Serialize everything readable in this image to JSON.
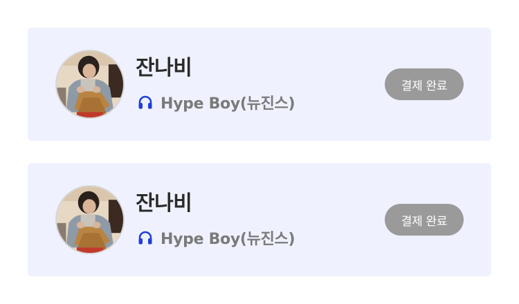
{
  "cards": [
    {
      "title": "잔나비",
      "song": "Hype Boy(뉴진스)",
      "status_label": "결제 완료",
      "icon": "headphones-icon"
    },
    {
      "title": "잔나비",
      "song": "Hype Boy(뉴진스)",
      "status_label": "결제 완료",
      "icon": "headphones-icon"
    }
  ],
  "colors": {
    "card_background": "#eff2fe",
    "accent": "#1f3fd8",
    "status_button": "#9a9a9a",
    "title_text": "#2a2a2a",
    "song_text": "#7a7a7a"
  }
}
